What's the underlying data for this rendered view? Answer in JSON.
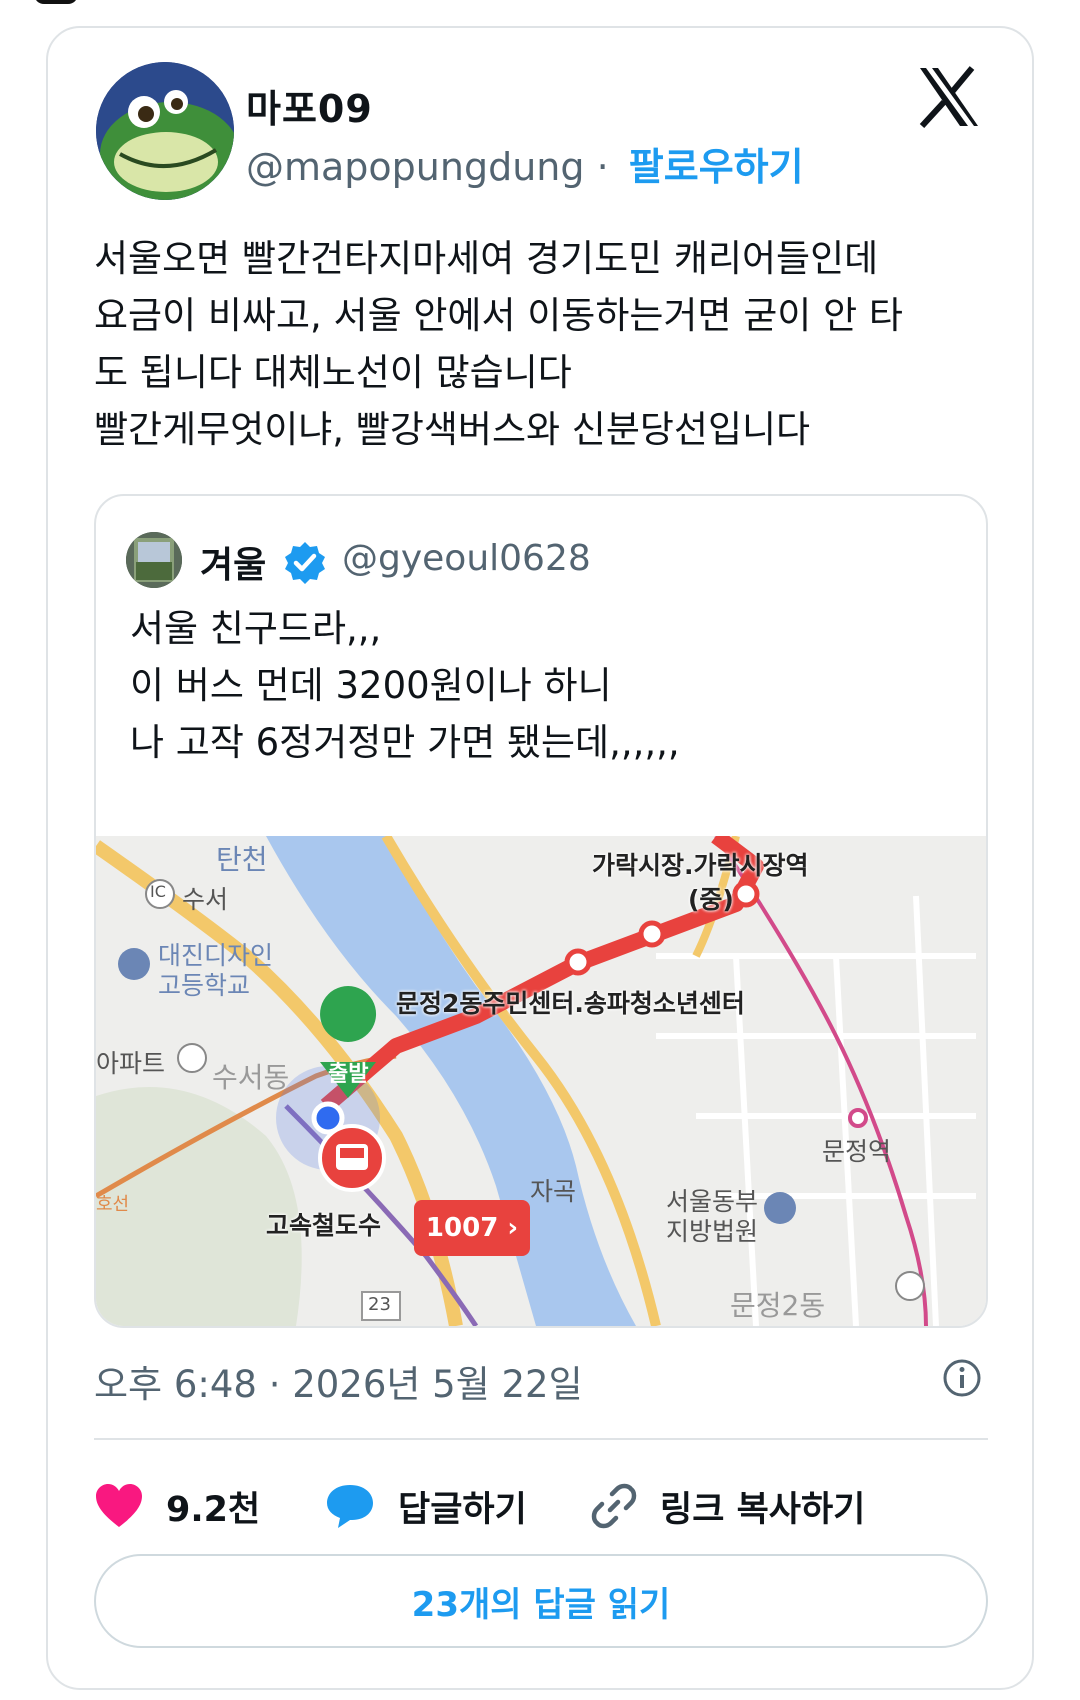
{
  "tweet": {
    "author_name": "마포09",
    "author_handle": "@mapopungdung",
    "separator": "·",
    "follow_label": "팔로우하기",
    "text": "서울오면 빨간건타지마세여 경기도민 캐리어들인데\n요금이 비싸고, 서울 안에서 이동하는거면 굳이 안 타\n도 됩니다 대체노선이 많습니다\n빨간게무엇이냐, 빨강색버스와 신분당선입니다",
    "timestamp": "오후 6:48 · 2026년 5월 22일"
  },
  "quote": {
    "author_name": "겨울",
    "author_handle": "@gyeoul0628",
    "text": "서울 친구드라,,,\n이 버스 먼데 3200원이나 하니\n나 고작 6정거정만 가면 됐는데,,,,,,"
  },
  "map": {
    "labels": {
      "tancheon": "탄천",
      "ic_badge": "IC",
      "suseo": "수서",
      "school1": "대진디자인",
      "school2": "고등학교",
      "apt": "아파트",
      "suseodong": "수서동",
      "garak": "가락시장.가락시장역",
      "garak_sub": "(중)",
      "munjeong_center": "문정2동주민센터.송파청소년센터",
      "start": "출발",
      "munjeong_station": "문정역",
      "seoul_court1": "서울동부",
      "seoul_court2": "지방법원",
      "jagok": "자곡",
      "highspeed": "고속철도수",
      "road23": "23",
      "munjeong2dong": "문정2동",
      "line_label": "호선"
    },
    "bus_number": "1007 ›",
    "colors": {
      "route": "#e8423e",
      "river": "#a9c7ee",
      "road": "#f3c86a"
    }
  },
  "actions": {
    "like_count": "9.2천",
    "reply_label": "답글하기",
    "copy_link_label": "링크 복사하기"
  },
  "read_replies_label": "23개의 답글 읽기",
  "colors": {
    "accent": "#1d9bf0",
    "like": "#f91880",
    "muted": "#536471"
  },
  "icons": [
    "x-logo-icon",
    "verified-badge-icon",
    "info-icon",
    "heart-icon",
    "reply-bubble-icon",
    "link-icon"
  ]
}
